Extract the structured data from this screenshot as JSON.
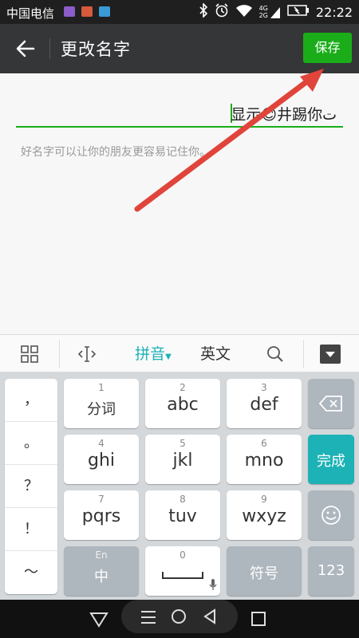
{
  "status_bar": {
    "carrier": "中国电信",
    "network_labels": [
      "4G",
      "2G"
    ],
    "time": "22:22"
  },
  "toolbar": {
    "title": "更改名字",
    "save_label": "保存",
    "back_icon": "arrow-left-icon"
  },
  "form": {
    "name_value": "显示​😊井踢你ت",
    "hint": "好名字可以让你的朋友更容易记住你。"
  },
  "ime_bar": {
    "pinyin_label": "拼音",
    "english_label": "英文"
  },
  "keyboard": {
    "punctuation": [
      "，",
      "。",
      "？",
      "！",
      "～"
    ],
    "keys": [
      {
        "num": "1",
        "label": "分词"
      },
      {
        "num": "2",
        "label": "abc"
      },
      {
        "num": "3",
        "label": "def"
      },
      {
        "num": "4",
        "label": "ghi"
      },
      {
        "num": "5",
        "label": "jkl"
      },
      {
        "num": "6",
        "label": "mno"
      },
      {
        "num": "7",
        "label": "pqrs"
      },
      {
        "num": "8",
        "label": "tuv"
      },
      {
        "num": "9",
        "label": "wxyz"
      }
    ],
    "done_label": "完成",
    "lang_switch_top": "En",
    "lang_switch_main": "中",
    "space_num": "0",
    "symbol_label": "符号",
    "numbers_label": "123"
  },
  "colors": {
    "accent_green": "#1aad19",
    "toolbar_bg": "#353638",
    "done_teal": "#1db2b6",
    "arrow_red": "#e0443a"
  }
}
